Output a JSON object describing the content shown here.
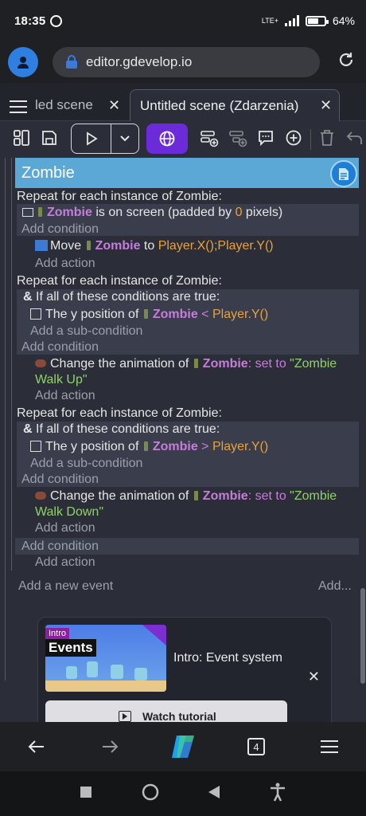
{
  "status": {
    "time": "18:35",
    "network": "LTE+",
    "battery": "64%"
  },
  "browser": {
    "url": "editor.gdevelop.io"
  },
  "tabs": [
    {
      "label": "led scene",
      "close": "✕"
    },
    {
      "label": "Untitled scene (Zdarzenia)",
      "close": "✕"
    }
  ],
  "group": {
    "title": "Zombie"
  },
  "events": {
    "e1": {
      "repeat": "Repeat for each instance of Zombie:",
      "cond_obj": "Zombie",
      "cond_text": " is on screen (padded by ",
      "cond_num": "0",
      "cond_tail": " pixels)",
      "add_condition": "Add condition",
      "act_move": "Move",
      "act_obj": "Zombie",
      "act_to": " to ",
      "act_expr": "Player.X();Player.Y()",
      "add_action": "Add action"
    },
    "e2": {
      "repeat": "Repeat for each instance of Zombie:",
      "and_label": "If all of these conditions are true:",
      "sub_text": "The y position of ",
      "sub_obj": "Zombie",
      "sub_op": " < ",
      "sub_expr": "Player.Y()",
      "add_sub": "Add a sub-condition",
      "add_condition": "Add condition",
      "act_text": "Change the animation of ",
      "act_obj": "Zombie",
      "act_set": ": set to ",
      "act_str": "\"Zombie Walk Up\"",
      "add_action": "Add action"
    },
    "e3": {
      "repeat": "Repeat for each instance of Zombie:",
      "and_label": "If all of these conditions are true:",
      "sub_text": "The y position of ",
      "sub_obj": "Zombie",
      "sub_op": " > ",
      "sub_expr": "Player.Y()",
      "add_sub": "Add a sub-condition",
      "add_condition": "Add condition",
      "act_text": "Change the animation of ",
      "act_obj": "Zombie",
      "act_set": ": set to ",
      "act_str": "\"Zombie Walk Down\"",
      "add_action": "Add action"
    },
    "group_add_condition": "Add condition",
    "group_add_action": "Add action",
    "add_event": "Add a new event",
    "add_more": "Add..."
  },
  "tutorial": {
    "tag1": "Intro",
    "tag2": "Events",
    "title": "Intro: Event system",
    "close": "✕",
    "watch": "Watch tutorial"
  },
  "bottom_nav": {
    "tabs_count": "4"
  }
}
